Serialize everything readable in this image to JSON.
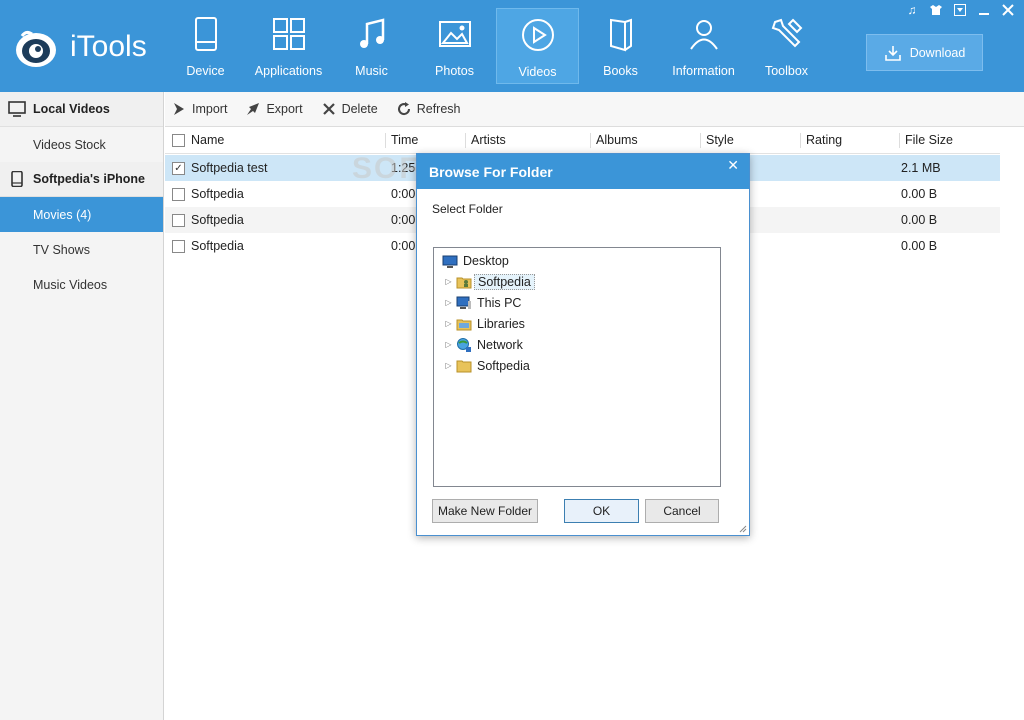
{
  "app": {
    "name": "iTools"
  },
  "nav": [
    {
      "label": "Device",
      "icon": "device-icon"
    },
    {
      "label": "Applications",
      "icon": "applications-icon"
    },
    {
      "label": "Music",
      "icon": "music-icon"
    },
    {
      "label": "Photos",
      "icon": "photos-icon"
    },
    {
      "label": "Videos",
      "icon": "videos-icon",
      "active": true
    },
    {
      "label": "Books",
      "icon": "books-icon"
    },
    {
      "label": "Information",
      "icon": "information-icon"
    },
    {
      "label": "Toolbox",
      "icon": "toolbox-icon"
    }
  ],
  "download": {
    "label": "Download"
  },
  "sidebar": {
    "local_group": "Local Videos",
    "local_items": [
      "Videos Stock"
    ],
    "device_group": "Softpedia's iPhone",
    "device_items": [
      "Movies (4)",
      "TV Shows",
      "Music Videos"
    ]
  },
  "toolbar": {
    "import": "Import",
    "export": "Export",
    "delete": "Delete",
    "refresh": "Refresh"
  },
  "table": {
    "columns": [
      "Name",
      "Time",
      "Artists",
      "Albums",
      "Style",
      "Rating",
      "File Size"
    ],
    "rows": [
      {
        "name": "Softpedia test",
        "time": "1:25",
        "size": "2.1 MB",
        "checked": true
      },
      {
        "name": "Softpedia",
        "time": "0:00",
        "size": "0.00 B"
      },
      {
        "name": "Softpedia",
        "time": "0:00",
        "size": "0.00 B"
      },
      {
        "name": "Softpedia",
        "time": "0:00",
        "size": "0.00 B"
      }
    ]
  },
  "watermark": "SOFTPEDIA",
  "dialog": {
    "title": "Browse For Folder",
    "subtitle": "Select Folder",
    "tree": [
      "Desktop",
      "Softpedia",
      "This PC",
      "Libraries",
      "Network",
      "Softpedia"
    ],
    "make_folder": "Make New Folder",
    "ok": "OK",
    "cancel": "Cancel"
  },
  "colors": {
    "accent": "#3b95d8",
    "selection": "#cde6f7"
  }
}
